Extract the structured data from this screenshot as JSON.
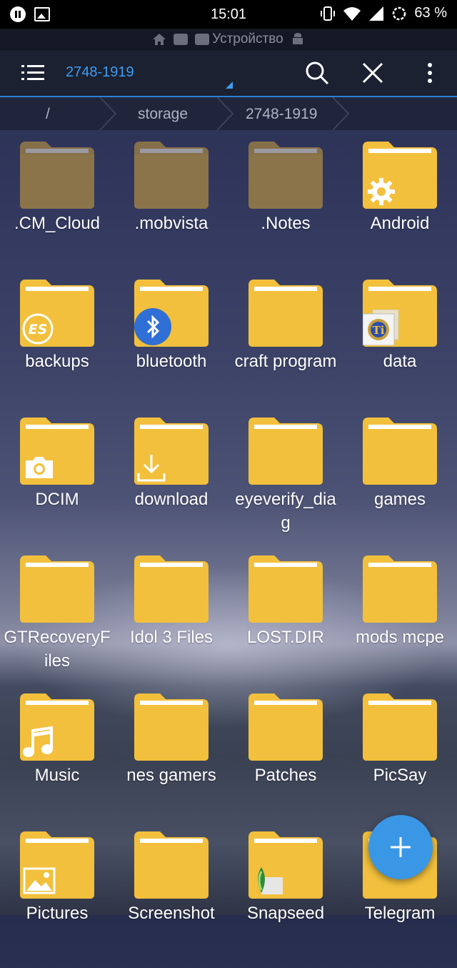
{
  "status_bar": {
    "time": "15:01",
    "battery": "63 %",
    "left_icons": [
      "pause-icon",
      "image-icon"
    ],
    "right_icons": [
      "vibrate-icon",
      "wifi-icon",
      "signal-icon",
      "battery-ring-icon"
    ]
  },
  "subheader": {
    "title": "Устройство",
    "icons": [
      "home-icon",
      "sd-card-icon",
      "sd-card-icon",
      "android-icon"
    ]
  },
  "toolbar": {
    "title": "2748-1919",
    "menu_icon": "hamburger-icon",
    "search_icon": "search-icon",
    "close_icon": "close-icon",
    "more_icon": "more-vert-icon"
  },
  "breadcrumb": [
    "/",
    "storage",
    "2748-1919"
  ],
  "colors": {
    "accent": "#3f9cf1",
    "folder": "#f2c03c",
    "folder_dark": "#8b744a",
    "fab": "#3a97e6"
  },
  "folders": [
    {
      "name": ".CM_Cloud",
      "style": "hidden",
      "badge": ""
    },
    {
      "name": ".mobvista",
      "style": "hidden",
      "badge": ""
    },
    {
      "name": ".Notes",
      "style": "hidden",
      "badge": ""
    },
    {
      "name": "Android",
      "style": "normal",
      "badge": "gear-icon"
    },
    {
      "name": "backups",
      "style": "normal",
      "badge": "es-logo-icon"
    },
    {
      "name": "bluetooth",
      "style": "normal",
      "badge": "bluetooth-icon"
    },
    {
      "name": "craft program",
      "style": "normal",
      "badge": ""
    },
    {
      "name": "data",
      "style": "normal",
      "badge": "titanium-backup-icon"
    },
    {
      "name": "DCIM",
      "style": "normal",
      "badge": "camera-icon"
    },
    {
      "name": "download",
      "style": "normal",
      "badge": "download-icon"
    },
    {
      "name": "eyeverify_diag",
      "style": "normal",
      "badge": ""
    },
    {
      "name": "games",
      "style": "normal",
      "badge": ""
    },
    {
      "name": "GTRecoveryFiles",
      "style": "normal",
      "badge": ""
    },
    {
      "name": "Idol 3 Files",
      "style": "normal",
      "badge": ""
    },
    {
      "name": "LOST.DIR",
      "style": "normal",
      "badge": ""
    },
    {
      "name": "mods mcpe",
      "style": "normal",
      "badge": ""
    },
    {
      "name": "Music",
      "style": "normal",
      "badge": "music-note-icon"
    },
    {
      "name": "nes gamers",
      "style": "normal",
      "badge": ""
    },
    {
      "name": "Patches",
      "style": "normal",
      "badge": ""
    },
    {
      "name": "PicSay",
      "style": "normal",
      "badge": ""
    },
    {
      "name": "Pictures",
      "style": "normal",
      "badge": "picture-icon"
    },
    {
      "name": "Screenshot",
      "style": "normal",
      "badge": ""
    },
    {
      "name": "Snapseed",
      "style": "normal",
      "badge": "snapseed-icon"
    },
    {
      "name": "Telegram",
      "style": "normal",
      "badge": ""
    }
  ],
  "fab": {
    "icon": "plus-icon"
  }
}
